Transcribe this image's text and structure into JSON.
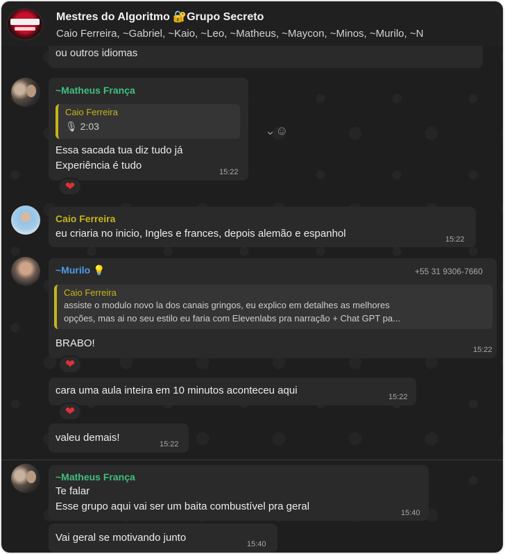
{
  "header": {
    "title": "Mestres do Algoritmo 🔐Grupo Secreto",
    "members": "Caio Ferreira, ~Gabriel, ~Kaio, ~Leo, ~Matheus, ~Maycon, ~Minos, ~Murilo, ~N"
  },
  "cut_message": {
    "text": "ou outros idiomas"
  },
  "messages": [
    {
      "sender": "~Matheus França",
      "quote_name": "Caio Ferreira",
      "quote_audio": "🎙 2:03",
      "lines": [
        "Essa sacada tua diz tudo já",
        "Experiência é tudo"
      ],
      "time": "15:22",
      "reaction": "❤"
    },
    {
      "sender": "Caio Ferreira",
      "lines": [
        "eu criaria no inicio, Ingles e frances, depois alemão e espanhol"
      ],
      "time": "15:22"
    },
    {
      "sender": "~Murilo 💡",
      "phone": "+55 31 9306-7660",
      "quote_name": "Caio Ferreira",
      "quote_lines": [
        "assiste o modulo novo la dos canais gringos, eu explico em detalhes as melhores",
        "opções, mas ai no seu estilo eu faria com Elevenlabs pra narração + Chat GPT pa..."
      ],
      "lines": [
        "BRABO!"
      ],
      "time": "15:22",
      "reaction": "❤"
    },
    {
      "lines": [
        "cara uma aula inteira em 10 minutos aconteceu aqui"
      ],
      "time": "15:22",
      "reaction": "❤"
    },
    {
      "lines": [
        "valeu demais!"
      ],
      "time": "15:22"
    },
    {
      "sender": "~Matheus França",
      "lines": [
        "Te falar",
        "Esse grupo aqui vai ser um baita combustível pra geral"
      ],
      "time": "15:40"
    },
    {
      "lines": [
        "Vai geral se motivando junto"
      ],
      "time": "15:40"
    }
  ],
  "colors": {
    "background": "#1e1e1e",
    "bubble": "#2a2a2a",
    "matheus": "#3fbf7f",
    "caio": "#c5b51b",
    "murilo": "#4e9be8",
    "reaction": "#e0303a"
  }
}
